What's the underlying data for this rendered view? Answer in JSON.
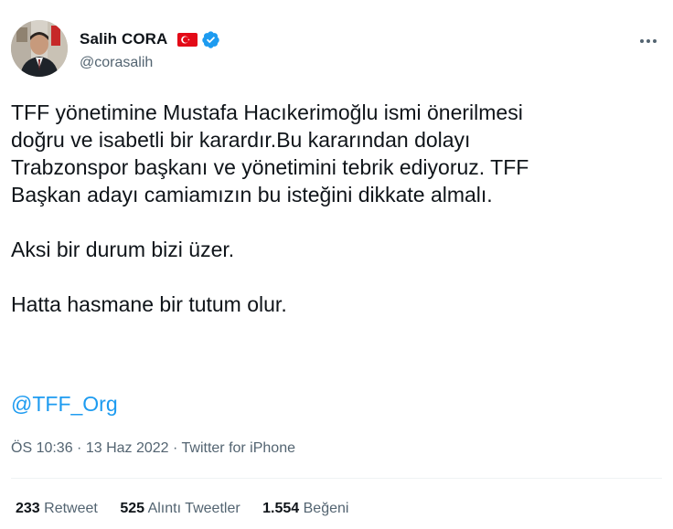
{
  "author": {
    "name": "Salih CORA",
    "handle": "@corasalih",
    "flag_icon": "turkey-flag-icon",
    "verified_icon": "verified-badge-icon"
  },
  "tweet": {
    "paragraph_1": "TFF yönetimine Mustafa Hacıkerimoğlu ismi önerilmesi\ndoğru ve isabetli bir karardır.Bu kararından dolayı\nTrabzonspor başkanı ve yönetimini tebrik ediyoruz. TFF\nBaşkan adayı camiamızın bu isteğini dikkate almalı.",
    "paragraph_2": "Aksi bir durum bizi üzer.",
    "paragraph_3": "Hatta hasmane bir tutum olur.",
    "mention": "@TFF_Org"
  },
  "meta": {
    "time": "ÖS 10:36",
    "separator": " · ",
    "date": "13 Haz 2022",
    "source": "Twitter for iPhone"
  },
  "stats": {
    "retweets_count": "233",
    "retweets_label": "Retweet",
    "quotes_count": "525",
    "quotes_label": "Alıntı Tweetler",
    "likes_count": "1.554",
    "likes_label": "Beğeni"
  },
  "colors": {
    "text": "#0f1419",
    "secondary": "#536471",
    "link": "#1d9bf0",
    "flag_red": "#e30a17",
    "verified_blue": "#1d9bf0"
  }
}
